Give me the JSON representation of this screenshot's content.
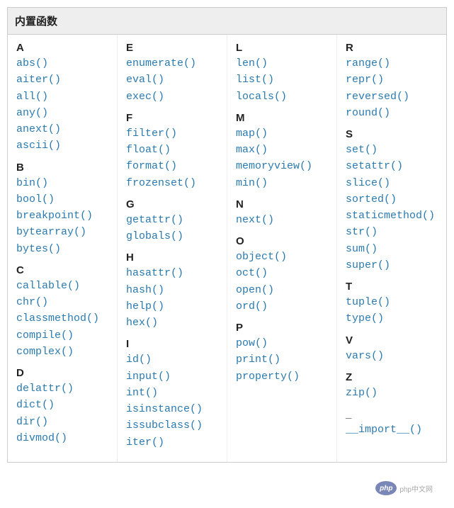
{
  "title": "内置函数",
  "columns": [
    [
      {
        "letter": "A",
        "items": [
          "abs()",
          "aiter()",
          "all()",
          "any()",
          "anext()",
          "ascii()"
        ]
      },
      {
        "letter": "B",
        "items": [
          "bin()",
          "bool()",
          "breakpoint()",
          "bytearray()",
          "bytes()"
        ]
      },
      {
        "letter": "C",
        "items": [
          "callable()",
          "chr()",
          "classmethod()",
          "compile()",
          "complex()"
        ]
      },
      {
        "letter": "D",
        "items": [
          "delattr()",
          "dict()",
          "dir()",
          "divmod()"
        ]
      }
    ],
    [
      {
        "letter": "E",
        "items": [
          "enumerate()",
          "eval()",
          "exec()"
        ]
      },
      {
        "letter": "F",
        "items": [
          "filter()",
          "float()",
          "format()",
          "frozenset()"
        ]
      },
      {
        "letter": "G",
        "items": [
          "getattr()",
          "globals()"
        ]
      },
      {
        "letter": "H",
        "items": [
          "hasattr()",
          "hash()",
          "help()",
          "hex()"
        ]
      },
      {
        "letter": "I",
        "items": [
          "id()",
          "input()",
          "int()",
          "isinstance()",
          "issubclass()",
          "iter()"
        ]
      }
    ],
    [
      {
        "letter": "L",
        "items": [
          "len()",
          "list()",
          "locals()"
        ]
      },
      {
        "letter": "M",
        "items": [
          "map()",
          "max()",
          "memoryview()",
          "min()"
        ]
      },
      {
        "letter": "N",
        "items": [
          "next()"
        ]
      },
      {
        "letter": "O",
        "items": [
          "object()",
          "oct()",
          "open()",
          "ord()"
        ]
      },
      {
        "letter": "P",
        "items": [
          "pow()",
          "print()",
          "property()"
        ]
      }
    ],
    [
      {
        "letter": "R",
        "items": [
          "range()",
          "repr()",
          "reversed()",
          "round()"
        ]
      },
      {
        "letter": "S",
        "items": [
          "set()",
          "setattr()",
          "slice()",
          "sorted()",
          "staticmethod()",
          "str()",
          "sum()",
          "super()"
        ]
      },
      {
        "letter": "T",
        "items": [
          "tuple()",
          "type()"
        ]
      },
      {
        "letter": "V",
        "items": [
          "vars()"
        ]
      },
      {
        "letter": "Z",
        "items": [
          "zip()"
        ]
      },
      {
        "letter": "_",
        "items": [
          "__import__()"
        ]
      }
    ]
  ],
  "watermark": {
    "badge": "php",
    "text": "php中文网"
  }
}
